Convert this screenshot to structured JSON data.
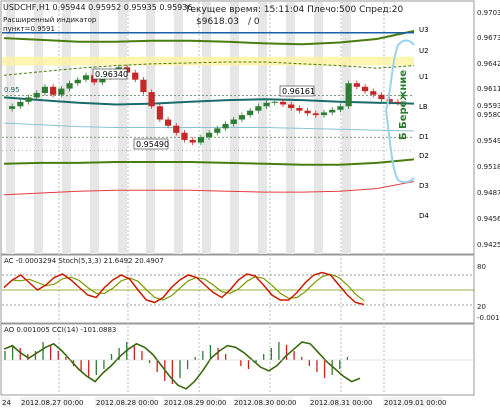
{
  "header": {
    "symbol_line": "USDCHF,H1  0.95944 0.95952 0.95935 0.95936",
    "server_time": "Текущее время: 15:11:04 Плечо:500 Спред:20",
    "balance": "$9618.03",
    "balance_suffix": "/ 0",
    "calc_label": "Расширенный индикатор",
    "calc_value": "пункт=0.9591"
  },
  "colors": {
    "candle_up": "#2e7d32",
    "candle_down": "#c62828",
    "pivot_line": "#1a6b6b",
    "resistance_line": "#4a7d10",
    "support_line": "#4a7d10",
    "zone": "#fff3a0",
    "stoch_main": "#cc1a00",
    "stoch_signal": "#7a9a00",
    "ao_up": "#2e7d32",
    "ao_down": "#cc2020",
    "cci_line": "#3a6a10",
    "forecast": "#9ad4ea",
    "hline_blue": "#1a5fa8",
    "grid": "#e6e6e6"
  },
  "annotations": {
    "a1": "0.96340",
    "a2": "0.95490",
    "a3": "0.96161",
    "a4": "0.95",
    "label_vertical": "Б Бережние"
  },
  "levels": {
    "U3": "U3",
    "U2": "U2",
    "U1": "U1",
    "LB": "LB",
    "D1": "D1",
    "D2": "D2",
    "D3": "D3",
    "D4": "D4"
  },
  "chart_data": {
    "type": "line",
    "title": "USDCHF,H1",
    "price_ticks": [
      "0.97033",
      "0.96738",
      "0.96427",
      "0.96115",
      "0.95936",
      "0.95803",
      "0.95493",
      "0.95183",
      "0.94873",
      "0.94563",
      "0.94253"
    ],
    "ylim": [
      0.94253,
      0.97033
    ],
    "time_labels": [
      "24",
      "2012.08.27 00:00",
      "2012.08.28 00:00",
      "2012.08.29 00:00",
      "2012.08.30 00:00",
      "2012.08.31 00:00",
      "2012.09.01 00:00"
    ],
    "close": [
      0.959,
      0.9595,
      0.96,
      0.9605,
      0.9612,
      0.9603,
      0.961,
      0.9616,
      0.962,
      0.9625,
      0.9617,
      0.9623,
      0.963,
      0.9634,
      0.9628,
      0.962,
      0.9606,
      0.959,
      0.9575,
      0.9568,
      0.956,
      0.9552,
      0.9549,
      0.9555,
      0.956,
      0.9565,
      0.957,
      0.9575,
      0.958,
      0.9585,
      0.959,
      0.9594,
      0.9595,
      0.9592,
      0.9588,
      0.9585,
      0.9582,
      0.958,
      0.9583,
      0.9586,
      0.959,
      0.9616,
      0.9612,
      0.9607,
      0.9603,
      0.9598,
      0.9595,
      0.9594
    ],
    "pivot_LB": [
      0.96,
      0.9597,
      0.9594,
      0.9592,
      0.9593,
      0.9595,
      0.9597,
      0.9598,
      0.9597,
      0.9595,
      0.9594,
      0.9593
    ],
    "U1": [
      0.9625,
      0.9629,
      0.9633,
      0.9636,
      0.9638,
      0.9639,
      0.964,
      0.964,
      0.9638,
      0.9636,
      0.9633,
      0.9636
    ],
    "U3": [
      0.9667,
      0.9665,
      0.9663,
      0.9663,
      0.9664,
      0.9664,
      0.9663,
      0.9661,
      0.966,
      0.9662,
      0.9666,
      0.9675
    ],
    "D1": [
      0.9571,
      0.9569,
      0.9567,
      0.9566,
      0.9566,
      0.9566,
      0.9566,
      0.9566,
      0.9565,
      0.9564,
      0.9563,
      0.9562
    ],
    "D3": [
      0.9525,
      0.9526,
      0.9526,
      0.9527,
      0.9527,
      0.9527,
      0.9526,
      0.9525,
      0.9524,
      0.9524,
      0.9526,
      0.953
    ],
    "D4": [
      0.949,
      0.9492,
      0.9494,
      0.9495,
      0.9495,
      0.9495,
      0.9494,
      0.9493,
      0.9493,
      0.9494,
      0.9497,
      0.9505
    ],
    "stoch_title": "AC -0.0003294   Stoch(5,3,3) 21.6492 20.4907",
    "stoch_ticks": [
      "80",
      "20",
      "-0.00173"
    ],
    "stoch_main": [
      55,
      70,
      80,
      65,
      50,
      60,
      75,
      82,
      70,
      55,
      40,
      35,
      55,
      70,
      80,
      72,
      50,
      30,
      25,
      35,
      55,
      70,
      80,
      75,
      60,
      45,
      35,
      50,
      70,
      82,
      78,
      60,
      40,
      30,
      30,
      45,
      65,
      80,
      85,
      80,
      60,
      40,
      25,
      21
    ],
    "ao_title": "AO 0.001005   CCI(14) -101.0883",
    "ao_values": [
      3,
      5,
      4,
      2,
      3,
      6,
      5,
      3,
      1,
      -2,
      -4,
      -6,
      -5,
      -3,
      2,
      4,
      6,
      5,
      3,
      -1,
      -4,
      -7,
      -8,
      -6,
      -3,
      1,
      3,
      5,
      4,
      2,
      0,
      -2,
      -3,
      -1,
      2,
      4,
      6,
      5,
      3,
      1,
      -2,
      -4,
      -6,
      -5,
      -3,
      1
    ],
    "cci_values": [
      60,
      80,
      40,
      10,
      40,
      70,
      90,
      50,
      0,
      -50,
      -90,
      -120,
      -70,
      -30,
      20,
      60,
      90,
      70,
      30,
      -30,
      -90,
      -140,
      -160,
      -120,
      -60,
      10,
      50,
      80,
      70,
      40,
      0,
      -40,
      -60,
      -30,
      20,
      60,
      100,
      90,
      40,
      -10,
      -50,
      -90,
      -120,
      -101
    ]
  }
}
